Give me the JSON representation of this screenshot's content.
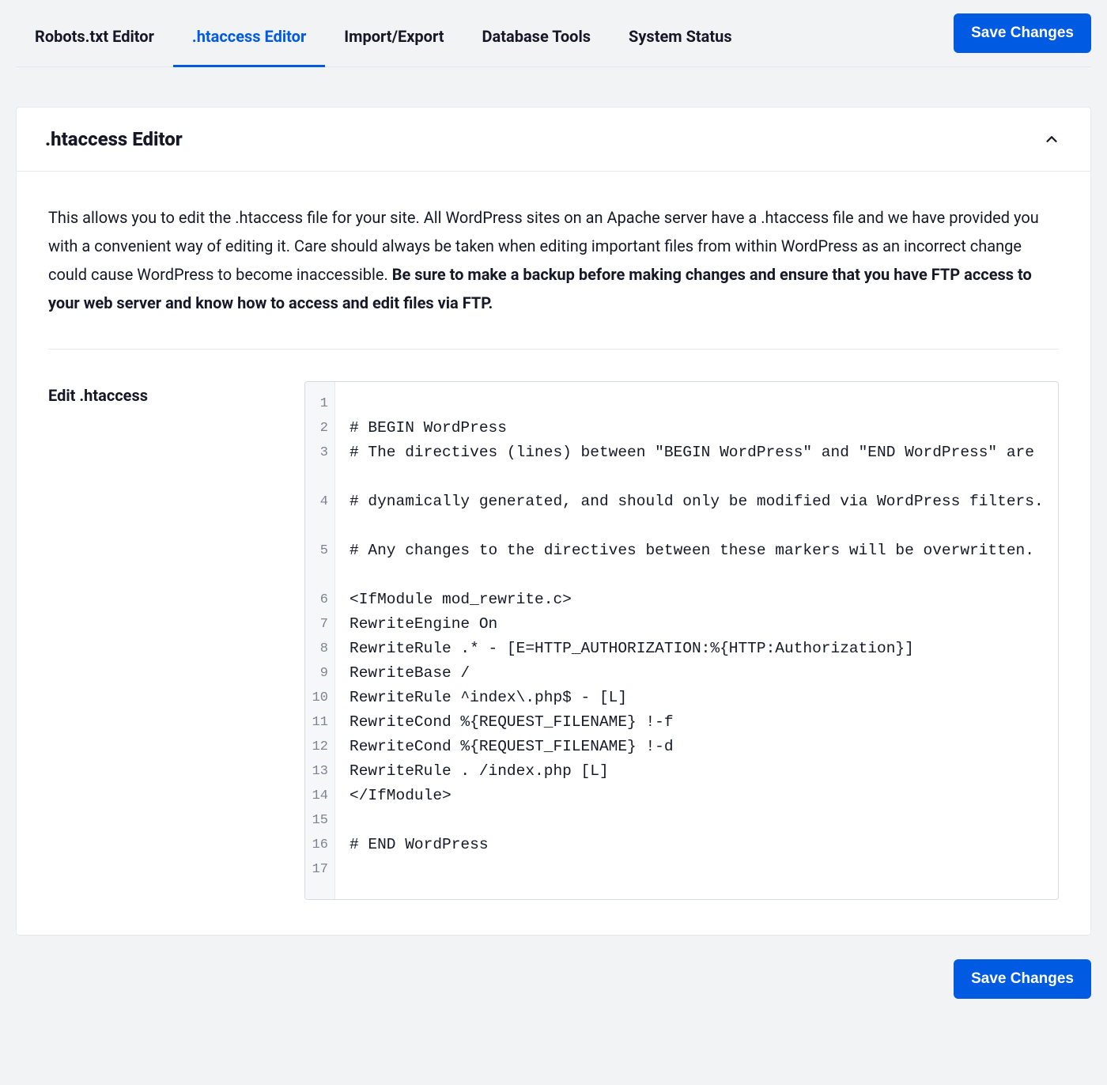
{
  "tabs": [
    {
      "label": "Robots.txt Editor",
      "active": false
    },
    {
      "label": ".htaccess Editor",
      "active": true
    },
    {
      "label": "Import/Export",
      "active": false
    },
    {
      "label": "Database Tools",
      "active": false
    },
    {
      "label": "System Status",
      "active": false
    }
  ],
  "save_button_label": "Save Changes",
  "panel": {
    "title": ".htaccess Editor",
    "description_plain": "This allows you to edit the .htaccess file for your site. All WordPress sites on an Apache server have a .htaccess file and we have provided you with a convenient way of editing it. Care should always be taken when editing important files from within WordPress as an incorrect change could cause WordPress to become inaccessible. ",
    "description_bold": "Be sure to make a backup before making changes and ensure that you have FTP access to your web server and know how to access and edit files via FTP.",
    "field_label": "Edit .htaccess"
  },
  "editor": {
    "lines": [
      "",
      "# BEGIN WordPress",
      "# The directives (lines) between \"BEGIN WordPress\" and \"END WordPress\" are",
      "# dynamically generated, and should only be modified via WordPress filters.",
      "# Any changes to the directives between these markers will be overwritten.",
      "<IfModule mod_rewrite.c>",
      "RewriteEngine On",
      "RewriteRule .* - [E=HTTP_AUTHORIZATION:%{HTTP:Authorization}]",
      "RewriteBase /",
      "RewriteRule ^index\\.php$ - [L]",
      "RewriteCond %{REQUEST_FILENAME} !-f",
      "RewriteCond %{REQUEST_FILENAME} !-d",
      "RewriteRule . /index.php [L]",
      "</IfModule>",
      "",
      "# END WordPress",
      ""
    ]
  }
}
